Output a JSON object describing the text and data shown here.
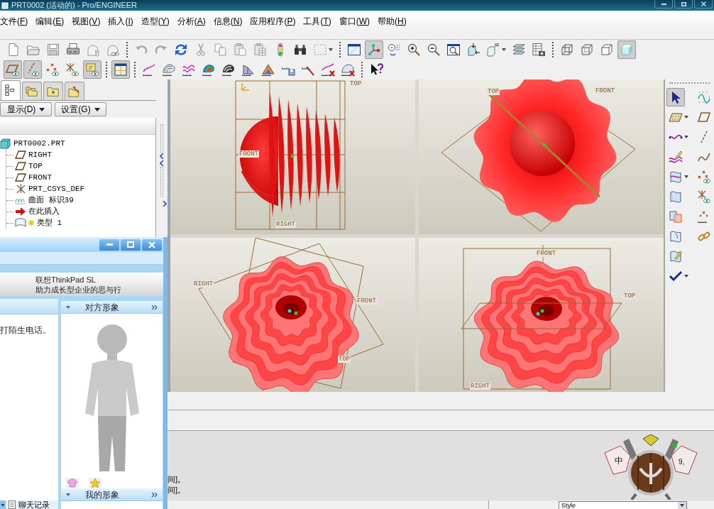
{
  "window": {
    "title": "PRT0002 (活动的) - Pro/ENGINEER",
    "buttons": [
      {
        "kind": "minimize"
      },
      {
        "kind": "maximize"
      },
      {
        "kind": "close"
      }
    ]
  },
  "menu": [
    "文件(F)",
    "编辑(E)",
    "视图(V)",
    "插入(I)",
    "造型(Y)",
    "分析(A)",
    "信息(N)",
    "应用程序(P)",
    "工具(T)",
    "窗口(W)",
    "帮助(H)"
  ],
  "toolbars": [
    [
      [
        {
          "kind": "new",
          "selected": false,
          "menu": false
        },
        {
          "kind": "open",
          "selected": false,
          "menu": false
        },
        {
          "kind": "save",
          "selected": false,
          "menu": false
        },
        {
          "kind": "print",
          "selected": false,
          "menu": false
        },
        {
          "kind": "mail",
          "selected": false,
          "menu": false
        },
        {
          "kind": "mail-link",
          "selected": false,
          "menu": false
        }
      ],
      [
        {
          "kind": "undo",
          "selected": false,
          "menu": false
        },
        {
          "kind": "redo",
          "selected": false,
          "menu": false
        },
        {
          "kind": "regen",
          "selected": false,
          "menu": false
        },
        {
          "kind": "cut",
          "selected": false,
          "menu": false
        },
        {
          "kind": "copy",
          "selected": false,
          "menu": false
        },
        {
          "kind": "paste",
          "selected": false,
          "menu": false
        },
        {
          "kind": "paste-special",
          "selected": false,
          "menu": false
        },
        {
          "kind": "traffic-light",
          "selected": false,
          "menu": false
        },
        {
          "kind": "find",
          "selected": false,
          "menu": false
        },
        {
          "kind": "select-box",
          "selected": false,
          "menu": true
        }
      ],
      [
        {
          "kind": "repaint",
          "selected": false,
          "menu": false
        },
        {
          "kind": "spin-center",
          "selected": true,
          "menu": false
        },
        {
          "kind": "orient-mode",
          "selected": false,
          "menu": false
        },
        {
          "kind": "zoom-in",
          "selected": false,
          "menu": false
        },
        {
          "kind": "zoom-out",
          "selected": false,
          "menu": false
        },
        {
          "kind": "refit",
          "selected": false,
          "menu": false
        },
        {
          "kind": "reorient",
          "selected": false,
          "menu": false
        },
        {
          "kind": "saved-views",
          "selected": false,
          "menu": true
        },
        {
          "kind": "layers",
          "selected": false,
          "menu": false
        },
        {
          "kind": "view-manager",
          "selected": false,
          "menu": false
        }
      ],
      [
        {
          "kind": "wireframe",
          "selected": false,
          "menu": false
        },
        {
          "kind": "hidden-line",
          "selected": false,
          "menu": false
        },
        {
          "kind": "no-hidden",
          "selected": false,
          "menu": false
        },
        {
          "kind": "shaded",
          "selected": true,
          "menu": false
        }
      ]
    ],
    [
      [
        {
          "kind": "planes",
          "selected": true,
          "menu": false
        },
        {
          "kind": "axes",
          "selected": true,
          "menu": false
        },
        {
          "kind": "points",
          "selected": false,
          "menu": false
        },
        {
          "kind": "csys",
          "selected": false,
          "menu": false
        },
        {
          "kind": "annotations",
          "selected": true,
          "menu": false
        }
      ],
      [
        {
          "kind": "grid",
          "selected": true,
          "menu": false
        }
      ],
      [
        {
          "kind": "curve-analysis",
          "selected": false,
          "menu": false
        },
        {
          "kind": "section-analysis",
          "selected": false,
          "menu": false
        },
        {
          "kind": "curvature",
          "selected": false,
          "menu": false
        },
        {
          "kind": "shade-curvature",
          "selected": false,
          "menu": false
        },
        {
          "kind": "reflection",
          "selected": false,
          "menu": false
        },
        {
          "kind": "draft",
          "selected": false,
          "menu": false
        },
        {
          "kind": "slope",
          "selected": false,
          "menu": false
        },
        {
          "kind": "saved-analysis",
          "selected": false,
          "menu": false
        },
        {
          "kind": "hide-analysis",
          "selected": false,
          "menu": false
        },
        {
          "kind": "delete-analysis",
          "selected": false,
          "menu": false
        },
        {
          "kind": "delete-all-analysis",
          "selected": false,
          "menu": false
        }
      ],
      [
        {
          "kind": "help",
          "selected": false,
          "menu": false
        }
      ]
    ]
  ],
  "model_tree": {
    "tabs": [
      {
        "kind": "tree",
        "selected": true
      },
      {
        "kind": "folders",
        "selected": false
      },
      {
        "kind": "favorites",
        "selected": false
      },
      {
        "kind": "tools",
        "selected": false
      }
    ],
    "buttons": [
      "显示(D)",
      "设置(G)"
    ],
    "items": [
      {
        "kind": "part",
        "label": "PRT0002.PRT",
        "children": [
          {
            "kind": "plane",
            "label": "RIGHT"
          },
          {
            "kind": "plane",
            "label": "TOP"
          },
          {
            "kind": "plane",
            "label": "FRONT"
          },
          {
            "kind": "csys",
            "label": "PRT_CSYS_DEF"
          },
          {
            "kind": "surface",
            "label": "曲面 标识39"
          },
          {
            "kind": "insert",
            "label": "在此插入"
          },
          {
            "kind": "new-surface",
            "label": "类型 1"
          }
        ]
      }
    ]
  },
  "viewports": [
    {
      "kind": "side",
      "labels": [
        "FRONT",
        "RIGHT",
        "TOP"
      ]
    },
    {
      "kind": "top",
      "labels": [
        "TOP",
        "FRONT"
      ]
    },
    {
      "kind": "iso-left",
      "labels": [
        "RIGHT",
        "FRONT",
        "TOP"
      ]
    },
    {
      "kind": "iso-right",
      "labels": [
        "FRONT",
        "TOP",
        "RIGHT"
      ]
    }
  ],
  "right_toolbar": [
    [
      {
        "kind": "select",
        "selected": true,
        "menu": false
      },
      {
        "kind": "plane-dots",
        "selected": false,
        "menu": true
      },
      {
        "kind": "curve",
        "selected": false,
        "menu": true
      },
      {
        "kind": "sketch-curve",
        "selected": false,
        "menu": false
      },
      {
        "kind": "surface",
        "selected": false,
        "menu": true
      },
      {
        "kind": "boundary",
        "selected": false,
        "menu": false
      },
      {
        "kind": "merge",
        "selected": false,
        "menu": false
      },
      {
        "kind": "trim",
        "selected": false,
        "menu": false
      },
      {
        "kind": "edit",
        "selected": false,
        "menu": false
      },
      {
        "kind": "check",
        "selected": false,
        "menu": true
      }
    ],
    [
      {
        "kind": "curve-points",
        "selected": false,
        "menu": false
      },
      {
        "kind": "plane",
        "selected": false,
        "menu": false
      },
      {
        "kind": "axis",
        "selected": false,
        "menu": false
      },
      {
        "kind": "sketch",
        "selected": false,
        "menu": false
      },
      {
        "kind": "points",
        "selected": false,
        "menu": false
      },
      {
        "kind": "csys",
        "selected": false,
        "menu": false
      },
      {
        "kind": "offset-point",
        "selected": false,
        "menu": false
      },
      {
        "kind": "chain",
        "selected": false,
        "menu": false
      }
    ]
  ],
  "messages": [
    "间]。",
    "间]。"
  ],
  "status_bar": {
    "style_field": {
      "value": "Style"
    }
  },
  "chat_window": {
    "buttons": [
      {
        "kind": "minimize"
      },
      {
        "kind": "maximize"
      },
      {
        "kind": "close"
      }
    ],
    "ad": [
      "联想ThinkPad SL",
      "助力成长型企业的思与行"
    ],
    "message": "打陌生电话。",
    "panels": [
      {
        "title": "对方形象",
        "expanded": true
      },
      {
        "title": "我的形象",
        "expanded": true
      }
    ],
    "avatar_tools": [
      {
        "kind": "shirt"
      },
      {
        "kind": "star"
      }
    ],
    "history_button": "聊天记录"
  },
  "ime": {
    "labels": [
      "中",
      "9,"
    ]
  }
}
